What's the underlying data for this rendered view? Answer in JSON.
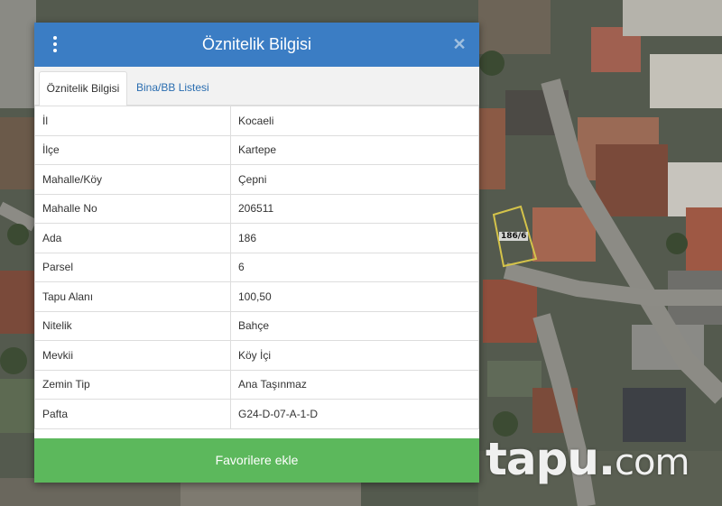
{
  "dialog": {
    "title": "Öznitelik Bilgisi",
    "menu_icon": "kebab-menu-icon",
    "close_icon": "close-icon"
  },
  "tabs": [
    {
      "label": "Öznitelik Bilgisi",
      "active": true
    },
    {
      "label": "Bina/BB Listesi",
      "active": false
    }
  ],
  "attributes": [
    {
      "key": "İl",
      "value": "Kocaeli"
    },
    {
      "key": "İlçe",
      "value": "Kartepe"
    },
    {
      "key": "Mahalle/Köy",
      "value": "Çepni"
    },
    {
      "key": "Mahalle No",
      "value": "206511"
    },
    {
      "key": "Ada",
      "value": "186"
    },
    {
      "key": "Parsel",
      "value": "6"
    },
    {
      "key": "Tapu Alanı",
      "value": "100,50"
    },
    {
      "key": "Nitelik",
      "value": "Bahçe"
    },
    {
      "key": "Mevkii",
      "value": "Köy İçi"
    },
    {
      "key": "Zemin Tip",
      "value": "Ana Taşınmaz"
    },
    {
      "key": "Pafta",
      "value": "G24-D-07-A-1-D"
    }
  ],
  "favorite_button": "Favorilere ekle",
  "map": {
    "parcel_label": "186/6"
  },
  "watermark": {
    "name": "tapu",
    "dot": ".",
    "tld": "com"
  },
  "colors": {
    "header": "#3b7dc4",
    "button": "#5cb85c",
    "tab_link": "#2a6db0"
  }
}
